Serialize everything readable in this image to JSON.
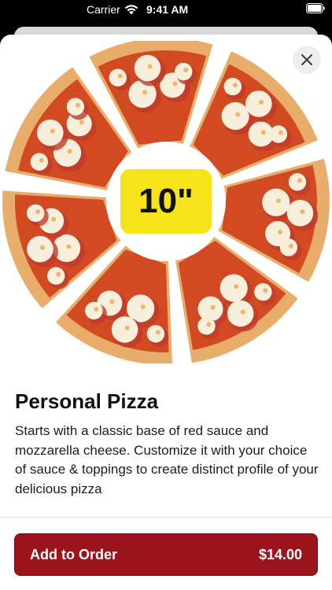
{
  "status_bar": {
    "carrier": "Carrier",
    "time": "9:41 AM"
  },
  "product": {
    "size_badge": "10\"",
    "title": "Personal Pizza",
    "description": "Starts with a classic base of red sauce and mozzarella cheese. Customize it with your choice of sauce & toppings to create distinct profile of your delicious pizza"
  },
  "footer": {
    "add_label": "Add to Order",
    "price": "$14.00"
  },
  "colors": {
    "accent": "#9c141b",
    "badge": "#f6e31a",
    "crust": "#e9ad6b",
    "sauce": "#d24a22",
    "cheese": "#f7efdc"
  },
  "icons": [
    "wifi-icon",
    "battery-icon",
    "close-icon",
    "pizza-image"
  ]
}
